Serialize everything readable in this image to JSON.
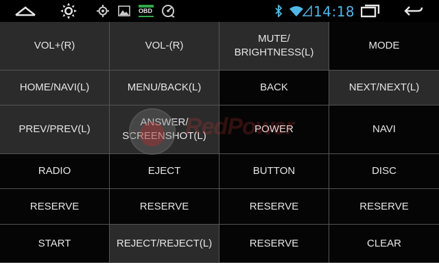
{
  "status_bar": {
    "time": "14:18",
    "obd_label": "OBD",
    "icons": [
      "chevron-up-icon",
      "brightness-icon",
      "gps-icon",
      "gallery-icon",
      "obd-icon",
      "speed-icon",
      "bluetooth-icon",
      "wifi-icon",
      "signal-icon",
      "recent-apps-icon",
      "back-icon"
    ]
  },
  "colors": {
    "accent": "#4fb7e8",
    "cell_light": "#2b2b2b",
    "cell_dark": "#050505",
    "text": "#e6e6e6"
  },
  "watermark": {
    "text": "RedPower"
  },
  "buttons": [
    {
      "label": "VOL+(R)",
      "shade": "light"
    },
    {
      "label": "VOL-(R)",
      "shade": "light"
    },
    {
      "label": "MUTE/\nBRIGHTNESS(L)",
      "shade": "light"
    },
    {
      "label": "MODE",
      "shade": "dark"
    },
    {
      "label": "HOME/NAVI(L)",
      "shade": "light"
    },
    {
      "label": "MENU/BACK(L)",
      "shade": "light"
    },
    {
      "label": "BACK",
      "shade": "dark"
    },
    {
      "label": "NEXT/NEXT(L)",
      "shade": "light"
    },
    {
      "label": "PREV/PREV(L)",
      "shade": "light"
    },
    {
      "label": "ANSWER/\nSCREENSHOT(L)",
      "shade": "light"
    },
    {
      "label": "POWER",
      "shade": "dark"
    },
    {
      "label": "NAVI",
      "shade": "dark"
    },
    {
      "label": "RADIO",
      "shade": "dark"
    },
    {
      "label": "EJECT",
      "shade": "dark"
    },
    {
      "label": "BUTTON",
      "shade": "dark"
    },
    {
      "label": "DISC",
      "shade": "dark"
    },
    {
      "label": "RESERVE",
      "shade": "dark"
    },
    {
      "label": "RESERVE",
      "shade": "dark"
    },
    {
      "label": "RESERVE",
      "shade": "dark"
    },
    {
      "label": "RESERVE",
      "shade": "dark"
    },
    {
      "label": "START",
      "shade": "dark"
    },
    {
      "label": "REJECT/REJECT(L)",
      "shade": "light"
    },
    {
      "label": "RESERVE",
      "shade": "dark"
    },
    {
      "label": "CLEAR",
      "shade": "dark"
    }
  ]
}
